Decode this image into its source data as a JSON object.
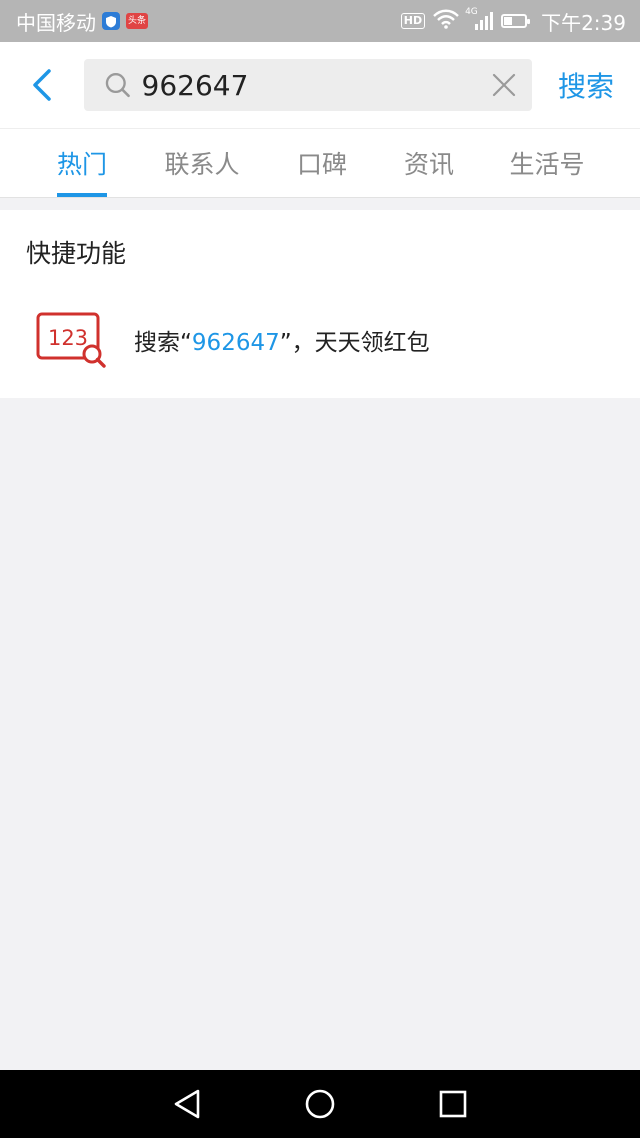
{
  "status_bar": {
    "carrier": "中国移动",
    "toutiao_label": "头条",
    "hd_label": "HD",
    "network_label": "4G",
    "time": "下午2:39"
  },
  "search": {
    "query": "962647",
    "button_label": "搜索"
  },
  "tabs": [
    {
      "label": "热门",
      "active": true
    },
    {
      "label": "联系人",
      "active": false
    },
    {
      "label": "口碑",
      "active": false
    },
    {
      "label": "资讯",
      "active": false
    },
    {
      "label": "生活号",
      "active": false
    }
  ],
  "quick_functions": {
    "title": "快捷功能",
    "icon_text": "123",
    "item": {
      "prefix": "搜索“",
      "query": "962647",
      "suffix": "”，天天领红包"
    }
  },
  "colors": {
    "accent": "#1e96e6",
    "icon_red": "#d0312d",
    "status_bar": "#b5b5b5"
  },
  "icons": [
    "back-icon",
    "search-icon",
    "clear-icon",
    "number-search-icon",
    "nav-back-icon",
    "nav-home-icon",
    "nav-recents-icon"
  ]
}
